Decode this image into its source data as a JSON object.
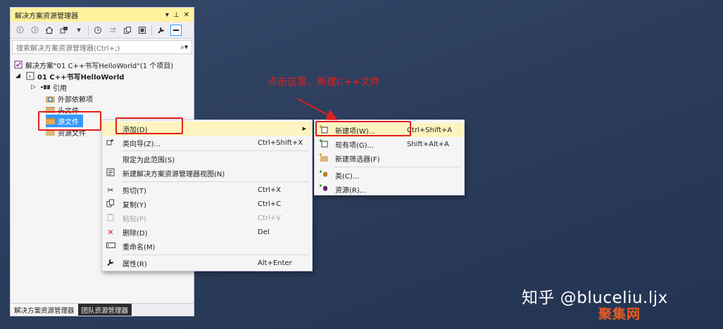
{
  "panel": {
    "title": "解决方案资源管理器",
    "title_controls": [
      "▾",
      "⊥",
      "✕"
    ],
    "toolbar_icons": [
      "back-icon",
      "forward-icon",
      "home-icon",
      "sync-icon",
      "history-icon",
      "pending-changes-icon",
      "collapse-icon",
      "show-all-icon",
      "properties-icon",
      "preview-icon"
    ],
    "search_placeholder": "搜索解决方案资源管理器(Ctrl+;)",
    "search_icon": "⌕▾"
  },
  "tree": {
    "solution": "解决方案\"01 C++书写HelloWorld\"(1 个项目)",
    "project": "01 C++书写HelloWorld",
    "references": "引用",
    "external_deps": "外部依赖项",
    "header_files": "头文件",
    "source_files": "源文件",
    "resource_files": "资源文件"
  },
  "bottom_tabs": [
    "解决方案资源管理器",
    "团队资源管理器"
  ],
  "context_menu": {
    "items": [
      {
        "label": "添加(D)",
        "shortcut": "",
        "icon": "",
        "submenu": true
      },
      {
        "label": "类向导(Z)...",
        "shortcut": "Ctrl+Shift+X",
        "icon": "class-wizard-icon"
      },
      {
        "label": "限定为此范围(S)",
        "shortcut": "",
        "icon": ""
      },
      {
        "label": "新建解决方案资源管理器视图(N)",
        "shortcut": "",
        "icon": "new-view-icon"
      },
      {
        "label": "剪切(T)",
        "shortcut": "Ctrl+X",
        "icon": "cut-icon"
      },
      {
        "label": "复制(Y)",
        "shortcut": "Ctrl+C",
        "icon": "copy-icon"
      },
      {
        "label": "粘贴(P)",
        "shortcut": "Ctrl+V",
        "icon": "paste-icon",
        "disabled": true
      },
      {
        "label": "删除(D)",
        "shortcut": "Del",
        "icon": "delete-icon"
      },
      {
        "label": "重命名(M)",
        "shortcut": "",
        "icon": "rename-icon"
      },
      {
        "label": "属性(R)",
        "shortcut": "Alt+Enter",
        "icon": "properties-icon"
      }
    ]
  },
  "submenu": {
    "items": [
      {
        "label": "新建项(W)...",
        "shortcut": "Ctrl+Shift+A",
        "icon": "new-item-icon"
      },
      {
        "label": "现有项(G)...",
        "shortcut": "Shift+Alt+A",
        "icon": "existing-item-icon"
      },
      {
        "label": "新建筛选器(F)",
        "shortcut": "",
        "icon": "new-filter-icon"
      },
      {
        "label": "类(C)...",
        "shortcut": "",
        "icon": "class-icon"
      },
      {
        "label": "资源(R)...",
        "shortcut": "",
        "icon": "resource-icon"
      }
    ]
  },
  "annotation": "点击这里，新建C++文件",
  "watermark": "知乎 @bluceliu.ljx",
  "watermark2": "聚集网",
  "colors": {
    "background": "#2c3d5c",
    "title_bar": "#fff29d",
    "selection": "#3399ff",
    "highlight_red": "#e0201b",
    "menu_hover": "#fdf4bf"
  }
}
